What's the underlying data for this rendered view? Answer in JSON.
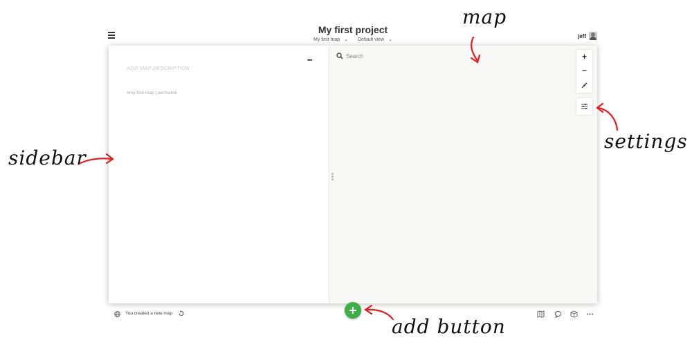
{
  "header": {
    "title": "My first project",
    "map_selector": "My first map",
    "view_selector": "Default view",
    "user_name": "jeff"
  },
  "sidebar": {
    "description_placeholder": "ADD MAP DESCRIPTION",
    "more_menu": "•••",
    "hashtag": "#my-first-map",
    "separator": "|",
    "permalink": "permalink"
  },
  "map": {
    "search_placeholder": "Search",
    "zoom_in": "+",
    "zoom_out": "−"
  },
  "footer": {
    "status": "You created a new map"
  },
  "annotations": {
    "map": "map",
    "settings": "settings",
    "sidebar": "sidebar",
    "add_button": "add button",
    "color": "#e41d1d"
  },
  "colors": {
    "accent_green": "#3fae49",
    "map_bg": "#f8f8f6"
  },
  "icons": [
    "hamburger-menu-icon",
    "chevron-down-icon",
    "search-icon",
    "plus-icon",
    "minus-icon",
    "location-icon",
    "settings-sliders-icon",
    "globe-icon",
    "undo-icon",
    "map-icon",
    "comment-icon",
    "cube-icon",
    "more-icon",
    "drag-handle-icon"
  ]
}
